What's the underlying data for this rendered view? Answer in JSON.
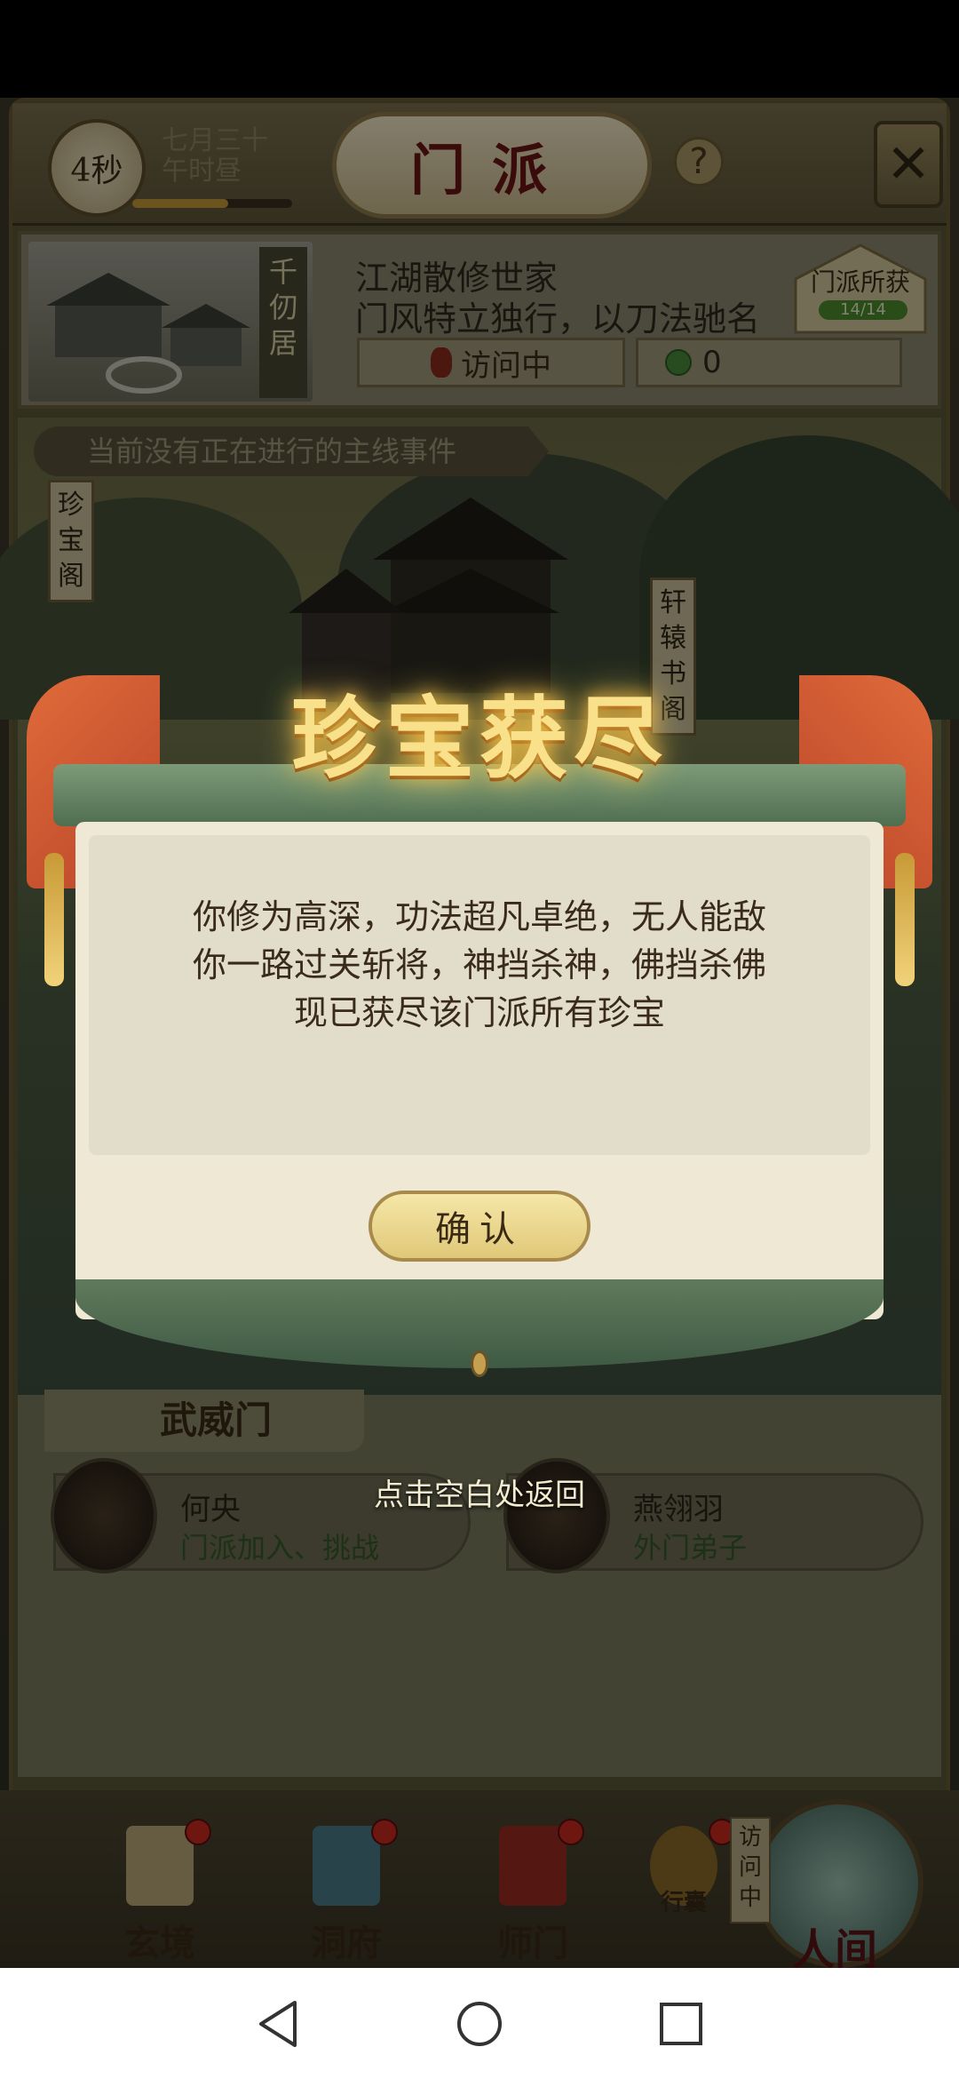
{
  "header": {
    "timer": "4秒",
    "date_line1": "七月三十",
    "date_line2": "午时昼",
    "timer_progress": 0.6,
    "title": "门派",
    "help_glyph": "?",
    "close_glyph": "✕"
  },
  "sect": {
    "vertical_name": "千仞居",
    "title": "江湖散修世家",
    "description": "门风特立独行，以刀法驰名",
    "visit_status": "访问中",
    "coin_value": "0",
    "reward_label": "门派所获",
    "reward_count": "14/14"
  },
  "scene": {
    "event_banner": "当前没有正在进行的主线事件",
    "left_sign": "珍宝阁",
    "right_sign": "轩辕书阁"
  },
  "members": {
    "sect_name": "武威门",
    "list": [
      {
        "name": "何央",
        "role": "门派加入、挑战"
      },
      {
        "name": "燕翎羽",
        "role": "外门弟子"
      }
    ]
  },
  "bottom_nav": {
    "items": [
      {
        "label": "玄境",
        "icon": "scroll-icon"
      },
      {
        "label": "洞府",
        "icon": "pavilion-icon"
      },
      {
        "label": "师门",
        "icon": "banner-icon"
      },
      {
        "label": "行囊",
        "icon": "bag-icon"
      }
    ],
    "visiting_tag": "访问中",
    "world_label": "人间"
  },
  "dialog": {
    "title": "珍宝获尽",
    "lines": [
      "你修为高深，功法超凡卓绝，无人能敌",
      "你一路过关斩将，神挡杀神，佛挡杀佛",
      "现已获尽该门派所有珍宝"
    ],
    "confirm_label": "确认",
    "tap_hint": "点击空白处返回"
  },
  "colors": {
    "accent_gold": "#f9e08a",
    "ribbon_red": "#e06b3a",
    "jade_green": "#5f7a5c",
    "parchment": "#efe8d4"
  }
}
